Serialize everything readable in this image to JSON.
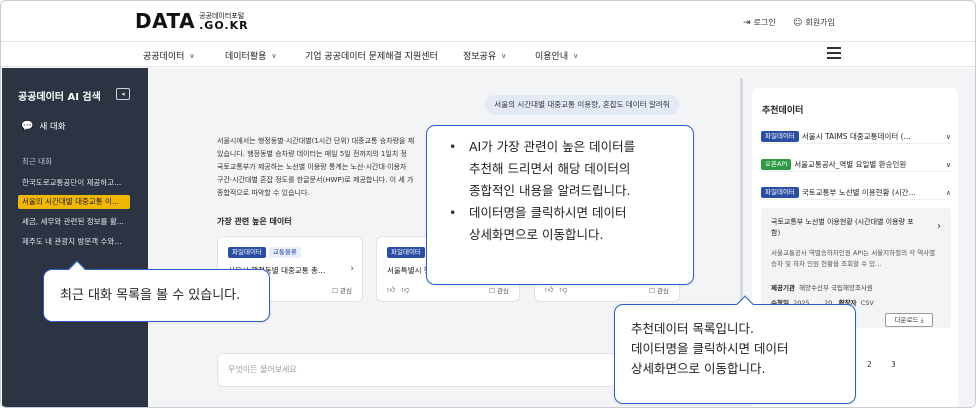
{
  "header": {
    "logo_main": "DATA",
    "logo_sub": "공공데이터포털",
    "logo_kr": ".GO.KR",
    "login": "로그인",
    "signup": "회원가입"
  },
  "nav": {
    "items": [
      "공공데이터",
      "데이터활용",
      "기업 공공데이터 문제해결 지원센터",
      "정보공유",
      "이용안내"
    ]
  },
  "sidebar": {
    "title": "공공데이터 AI 검색",
    "new_chat": "새 대화",
    "recent_label": "최근 대화",
    "history": [
      "한국도로교통공단이 제공하고...",
      "서울의 시간대별 대중교통 이...",
      "세금, 세무와 관련된 정보를 활...",
      "제주도 내 관광지 방문객 수와..."
    ]
  },
  "chat": {
    "user_message": "서울의 시간대별 대중교통 이용량, 혼잡도 데이터 알려줘",
    "answer_lines": [
      "서울시에서는 행정동별·시간대별(1시간 단위) 대중교통 승차량을 제",
      "있습니다. 행정동별 승차량 데이터는 매일 5일 전까지의 1일치 정",
      "국토교통부가 제공하는 노선별 이용량 통계는 노선·시간대·이용자",
      "구간·시간대별 혼잡 정도를 한글문서(HWP)로 제공합니다. 이 세 가",
      "종합적으로 파악할 수 있습니다."
    ],
    "related_title": "가장 관련 높은 데이터",
    "cards": [
      {
        "tag": "파일데이터",
        "category": "교통물류",
        "title": "서울시 행정동별 대중교통 총...",
        "like": "관심"
      },
      {
        "tag": "파일데이터",
        "title": "서울특별시 행",
        "like": "관심"
      }
    ],
    "input_placeholder": "무엇이든 물어보세요"
  },
  "recommend": {
    "title": "추천데이터",
    "items": [
      {
        "tag": "파일데이터",
        "title": "서울시 TAIMS 대중교통데이터 (..."
      },
      {
        "tag": "오픈API",
        "title": "서울교통공사_역별 요일별 환승인원"
      },
      {
        "tag": "파일데이터",
        "title": "국토교통부 노선별 이용현황 (시간..."
      }
    ],
    "detail": {
      "title": "국토교통부 노선별 이용현황 (시간대별 이용량 포함)",
      "desc": "서울교통공사 역별승하차인원 API는 서울지하철의 각 역사별 승차 및 하차 인원 현황을 조회할 수 있...",
      "provider_label": "제공기관",
      "provider": "해양수산부 국립해양조사원",
      "updated_label": "수정일",
      "updated": "2025",
      "updated_tail": "20",
      "ext_label": "확장자",
      "ext": "CSV",
      "download": "다운로드"
    },
    "pages": [
      "2",
      "3"
    ]
  },
  "callouts": {
    "recent": "최근 대화 목록을 볼 수 있습니다.",
    "ai_bullets": [
      "AI가 가장 관련이 높은 데이터를",
      "추천해 드리면서 해당 데이터의",
      "종합적인 내용을 알려드립니다.",
      "데이터명을 클릭하시면 데이터",
      "상세화면으로 이동합니다."
    ],
    "recommend_lines": [
      "추천데이터 목록입니다.",
      "데이터명을 클릭하시면 데이터",
      "상세화면으로 이동합니다."
    ]
  },
  "colors": {
    "sidebar_bg": "#2c3444",
    "active_history": "#f2b705",
    "file_tag": "#2a4ea3",
    "api_tag": "#2e9a46",
    "callout_border": "#2c5fc4"
  }
}
